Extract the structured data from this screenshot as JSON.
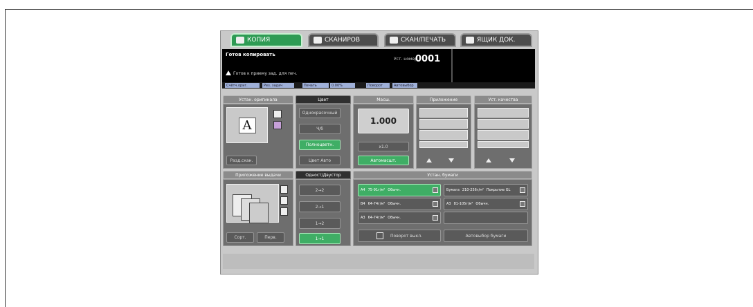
{
  "tabs": [
    {
      "label": "КОПИЯ",
      "state": "active"
    },
    {
      "label": "СКАНИРОВ",
      "state": "inactive"
    },
    {
      "label": "СКАН/ПЕЧАТЬ",
      "state": "inactive"
    },
    {
      "label": "ЯЩИК ДОК.",
      "state": "inactive"
    }
  ],
  "header": {
    "status": "Готов копировать",
    "setnum_label": "Уст. номер",
    "setnum_value": "0001",
    "sub_status": "Готов к приему зад. для печ."
  },
  "status_chips": [
    "Счётч.ориг.",
    "Рез. задач",
    "Печать",
    "0.00%",
    "Поворот",
    "Автовыбор"
  ],
  "original": {
    "header": "Устан. оригинала",
    "preview_letter": "A",
    "reduce_button": "Разд.скан."
  },
  "color": {
    "header": "Цвет",
    "buttons": [
      "Однокрасочный",
      "Ч/б",
      "Полноцветн.",
      "Цвет Авто"
    ],
    "selected_index": 2
  },
  "zoom": {
    "header": "Масш.",
    "value": "1.000",
    "x1_button": "x1.0",
    "auto_button": "Автомасшт."
  },
  "application": {
    "header": "Приложение"
  },
  "quality": {
    "header": "Уст. качества"
  },
  "output": {
    "header": "Приложение выдачи",
    "buttons": [
      "Сорт.",
      "Перв."
    ]
  },
  "duplex": {
    "header": "Одност/Двустор",
    "buttons": [
      "2→2",
      "2→1",
      "1→2",
      "1→1"
    ],
    "selected_index": 3
  },
  "paper": {
    "header": "Устан. бумаги",
    "trays": [
      {
        "tray": "1",
        "size": "A4",
        "weight": "75-91г/м²",
        "type": "Обычн."
      },
      {
        "tray": "2",
        "size": "B4",
        "weight": "64-74г/м²",
        "type": "Обычн."
      },
      {
        "tray": "3",
        "size": "A3",
        "weight": "64-74г/м²",
        "type": "Обычн."
      },
      {
        "tray": "Бумага",
        "size": "",
        "weight": "210-256г/м²",
        "type": "Покрытие GL"
      },
      {
        "tray": "5",
        "size": "A3",
        "weight": "81-105г/м²",
        "type": "Обычн."
      }
    ],
    "selected_index": 0,
    "rotate_button": "Поворот выкл.",
    "auto_paper_button": "Автовыбор бумаги"
  },
  "colors": {
    "accent": "#3fae65",
    "panel": "#6e6e6e",
    "screen_bg": "#c9c9c9"
  }
}
